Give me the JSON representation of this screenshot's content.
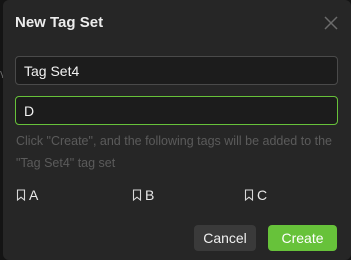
{
  "background": {
    "partial_char": "y"
  },
  "dialog": {
    "title": "New Tag Set",
    "close_icon": "close-icon",
    "tag_set_name": {
      "value": "Tag Set4",
      "placeholder": ""
    },
    "tags_input": {
      "value": "D",
      "placeholder": ""
    },
    "hint": "Click \"Create\", and the following tags will be added to the \"Tag Set4\" tag set",
    "tags": [
      {
        "label": "A",
        "icon": "bookmark-icon"
      },
      {
        "label": "B",
        "icon": "bookmark-icon"
      },
      {
        "label": "C",
        "icon": "bookmark-icon"
      }
    ],
    "cancel_label": "Cancel",
    "create_label": "Create"
  },
  "colors": {
    "accent": "#67c23a",
    "dialog_bg": "#262626",
    "hint_text": "#5b5b5b"
  }
}
